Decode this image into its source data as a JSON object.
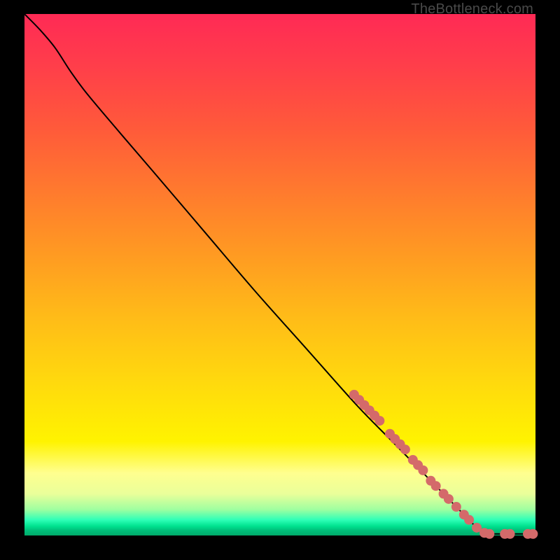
{
  "watermark": "TheBottleneck.com",
  "colors": {
    "curve": "#000000",
    "marker_fill": "#d46a6a",
    "marker_stroke": "#c05858"
  },
  "chart_data": {
    "type": "line",
    "title": "",
    "xlabel": "",
    "ylabel": "",
    "xlim": [
      0,
      100
    ],
    "ylim": [
      0,
      100
    ],
    "grid": false,
    "legend": false,
    "curve_note": "Monotone decreasing curve; starts at top-left, slight shoulder near x≈8, roughly linear descent to x≈90 y≈0, then flat along y≈0 to x=100.",
    "curve": [
      {
        "x": 0,
        "y": 100
      },
      {
        "x": 3,
        "y": 97
      },
      {
        "x": 6,
        "y": 93.5
      },
      {
        "x": 9,
        "y": 89
      },
      {
        "x": 12,
        "y": 85
      },
      {
        "x": 18,
        "y": 78
      },
      {
        "x": 25,
        "y": 70
      },
      {
        "x": 35,
        "y": 58.5
      },
      {
        "x": 45,
        "y": 47
      },
      {
        "x": 55,
        "y": 36
      },
      {
        "x": 65,
        "y": 25
      },
      {
        "x": 72,
        "y": 18
      },
      {
        "x": 78,
        "y": 12
      },
      {
        "x": 84,
        "y": 6
      },
      {
        "x": 88,
        "y": 2
      },
      {
        "x": 90,
        "y": 0.5
      },
      {
        "x": 93,
        "y": 0.3
      },
      {
        "x": 96,
        "y": 0.3
      },
      {
        "x": 100,
        "y": 0.3
      }
    ],
    "markers": [
      {
        "x": 64.5,
        "y": 27.0
      },
      {
        "x": 65.5,
        "y": 26.0
      },
      {
        "x": 66.5,
        "y": 25.0
      },
      {
        "x": 67.5,
        "y": 24.0
      },
      {
        "x": 68.5,
        "y": 23.0
      },
      {
        "x": 69.5,
        "y": 22.0
      },
      {
        "x": 71.5,
        "y": 19.5
      },
      {
        "x": 72.5,
        "y": 18.5
      },
      {
        "x": 73.5,
        "y": 17.5
      },
      {
        "x": 74.5,
        "y": 16.5
      },
      {
        "x": 76.0,
        "y": 14.5
      },
      {
        "x": 77.0,
        "y": 13.5
      },
      {
        "x": 78.0,
        "y": 12.5
      },
      {
        "x": 79.5,
        "y": 10.5
      },
      {
        "x": 80.5,
        "y": 9.5
      },
      {
        "x": 82.0,
        "y": 8.0
      },
      {
        "x": 83.0,
        "y": 7.0
      },
      {
        "x": 84.5,
        "y": 5.5
      },
      {
        "x": 86.0,
        "y": 4.0
      },
      {
        "x": 87.0,
        "y": 3.0
      },
      {
        "x": 88.5,
        "y": 1.5
      },
      {
        "x": 90.0,
        "y": 0.5
      },
      {
        "x": 91.0,
        "y": 0.3
      },
      {
        "x": 94.0,
        "y": 0.3
      },
      {
        "x": 95.0,
        "y": 0.3
      },
      {
        "x": 98.5,
        "y": 0.3
      },
      {
        "x": 99.5,
        "y": 0.3
      }
    ],
    "marker_radius_px": 7
  }
}
